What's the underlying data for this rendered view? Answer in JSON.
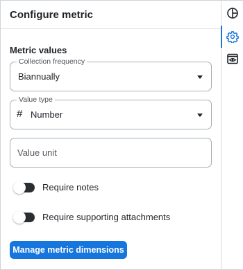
{
  "panel": {
    "title": "Configure metric",
    "section_title": "Metric values",
    "collection_frequency": {
      "label": "Collection frequency",
      "value": "Biannually"
    },
    "value_type": {
      "label": "Value type",
      "icon": "#",
      "value": "Number"
    },
    "value_unit": {
      "placeholder": "Value unit"
    },
    "toggles": [
      {
        "label": "Require notes",
        "on": false
      },
      {
        "label": "Require supporting attachments",
        "on": false
      }
    ],
    "primary_button": "Manage metric dimensions"
  },
  "rail": {
    "items": [
      {
        "icon": "pie-chart-icon",
        "active": false
      },
      {
        "icon": "gear-icon",
        "active": true
      },
      {
        "icon": "preview-icon",
        "active": false
      }
    ]
  },
  "colors": {
    "accent": "#1676dd",
    "toggle_off": "#2b2e31",
    "border": "#a7adb3"
  }
}
